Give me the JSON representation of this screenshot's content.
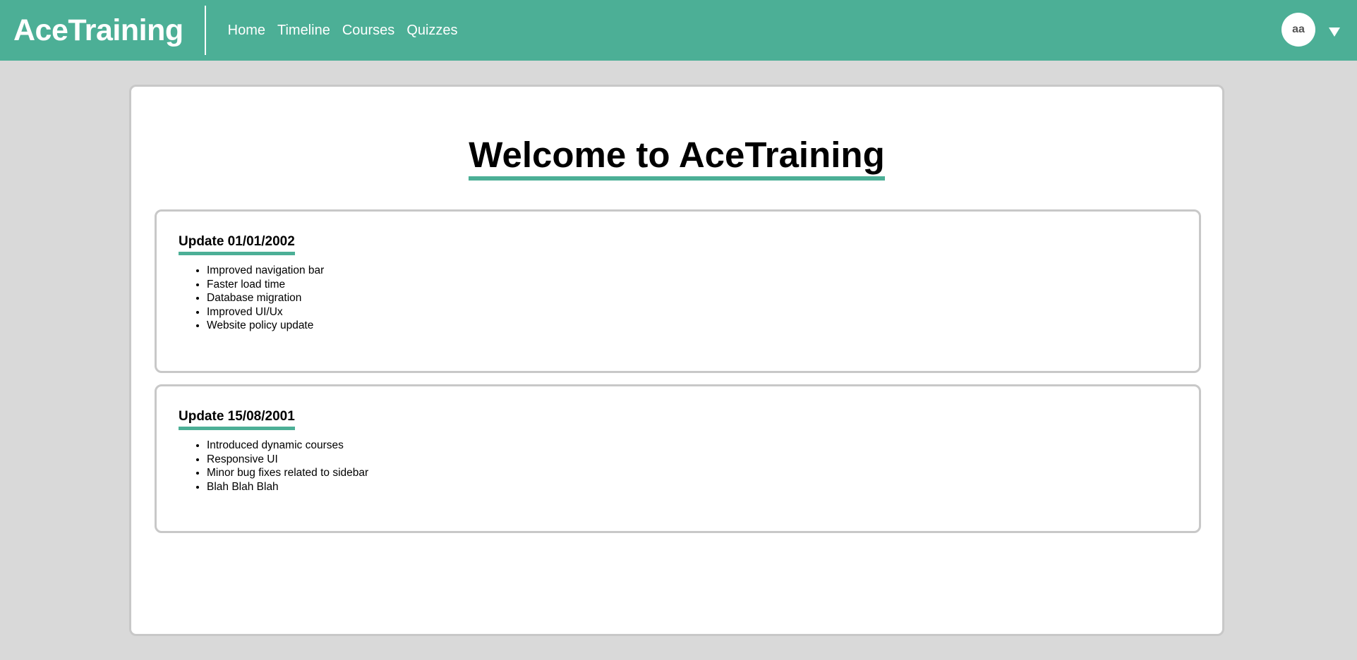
{
  "navbar": {
    "brand": "AceTraining",
    "links": [
      "Home",
      "Timeline",
      "Courses",
      "Quizzes"
    ],
    "avatar_initials": "aa",
    "dropdown_icon": "caret-down-icon"
  },
  "main": {
    "title": "Welcome to AceTraining",
    "updates": [
      {
        "title": "Update 01/01/2002",
        "items": [
          "Improved navigation bar",
          "Faster load time",
          "Database migration",
          "Improved UI/Ux",
          "Website policy update"
        ]
      },
      {
        "title": "Update 15/08/2001",
        "items": [
          "Introduced dynamic courses",
          "Responsive UI",
          "Minor bug fixes related to sidebar",
          "Blah Blah Blah"
        ]
      }
    ]
  },
  "colors": {
    "accent": "#4caf96",
    "background": "#d9d9d9",
    "card_border": "#c8c8c8"
  }
}
